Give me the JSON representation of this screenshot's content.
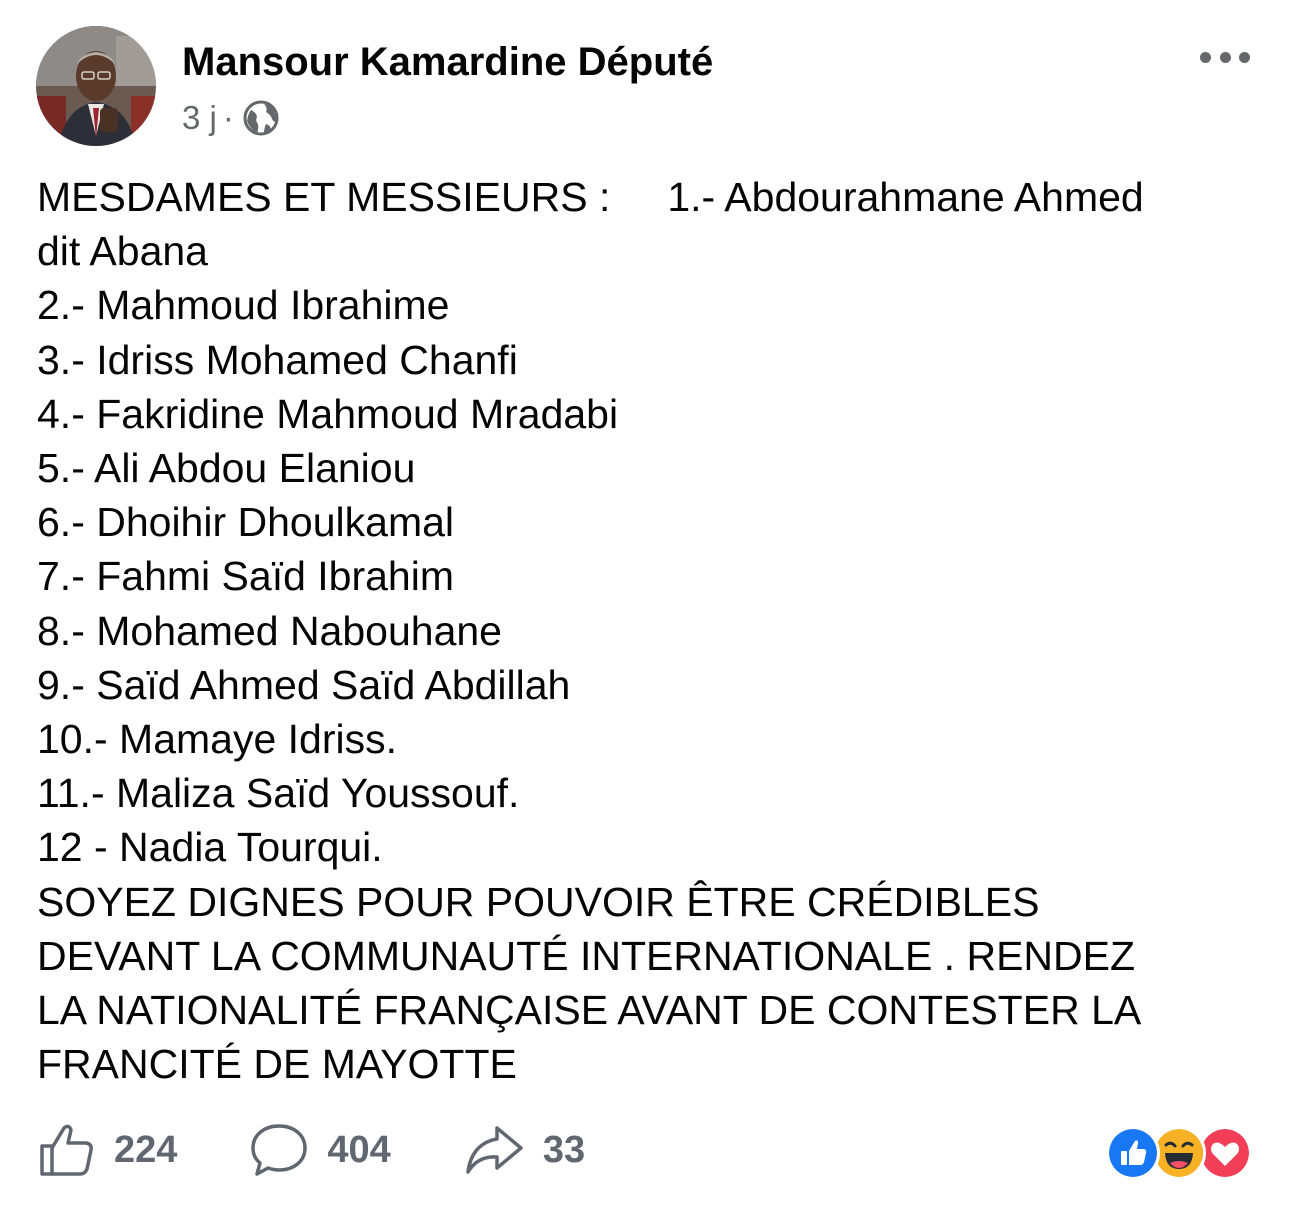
{
  "post": {
    "author": "Mansour Kamardine Député",
    "time": "3 j",
    "separator": "·",
    "privacy_icon": "globe-icon",
    "more_icon": "more-options-icon",
    "text_lines": [
      "MESDAMES ET MESSIEURS :     1.- Abdourahmane Ahmed",
      "dit Abana",
      "2.- Mahmoud Ibrahime",
      "3.- Idriss Mohamed Chanfi",
      "4.- Fakridine Mahmoud Mradabi",
      "5.- Ali Abdou Elaniou",
      "6.- Dhoihir Dhoulkamal",
      "7.- Fahmi Saïd Ibrahim",
      "8.- Mohamed Nabouhane",
      "9.- Saïd Ahmed Saïd Abdillah",
      "10.- Mamaye Idriss.",
      "11.- Maliza Saïd Youssouf.",
      "12 - Nadia Tourqui.",
      "SOYEZ DIGNES POUR POUVOIR ÊTRE CRÉDIBLES",
      "DEVANT LA COMMUNAUTÉ INTERNATIONALE . RENDEZ",
      "LA NATIONALITÉ FRANÇAISE AVANT DE CONTESTER LA",
      "FRANCITÉ DE MAYOTTE"
    ]
  },
  "actions": {
    "like_count": "224",
    "comment_count": "404",
    "share_count": "33"
  },
  "reactions": [
    "like",
    "haha",
    "love"
  ],
  "colors": {
    "text": "#050505",
    "secondary": "#65676b",
    "like_blue": "#1877f2",
    "haha_yellow": "#f7b125",
    "love_red": "#f33e58"
  }
}
